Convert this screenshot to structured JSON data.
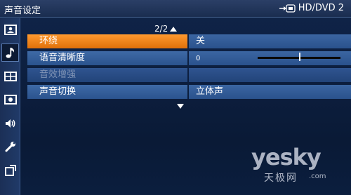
{
  "header": {
    "title": "声音设定",
    "source_label": "HD/DVD 2",
    "source_icon": "input-connector-icon"
  },
  "sidebar": {
    "items": [
      {
        "icon": "picture-icon",
        "active": false
      },
      {
        "icon": "music-note-icon",
        "active": true
      },
      {
        "icon": "screen-layout-icon",
        "active": false
      },
      {
        "icon": "settings-box-icon",
        "active": false
      },
      {
        "icon": "speaker-icon",
        "active": false
      },
      {
        "icon": "wrench-icon",
        "active": false
      },
      {
        "icon": "input-setup-icon",
        "active": false
      }
    ]
  },
  "menu": {
    "page_indicator": "2/2",
    "rows": [
      {
        "label": "环绕",
        "value": "关",
        "state": "selected"
      },
      {
        "label": "语音清晰度",
        "value": "0",
        "state": "normal",
        "slider_level": 0.5
      },
      {
        "label": "音效增强",
        "value": "",
        "state": "disabled"
      },
      {
        "label": "声音切换",
        "value": "立体声",
        "state": "normal"
      }
    ]
  },
  "watermark": {
    "brand": "yesky",
    "sub": "天极网",
    "domain": ".com"
  },
  "colors": {
    "selected": "#f08418",
    "row": "#3460a0",
    "background": "#0b1d3a"
  }
}
